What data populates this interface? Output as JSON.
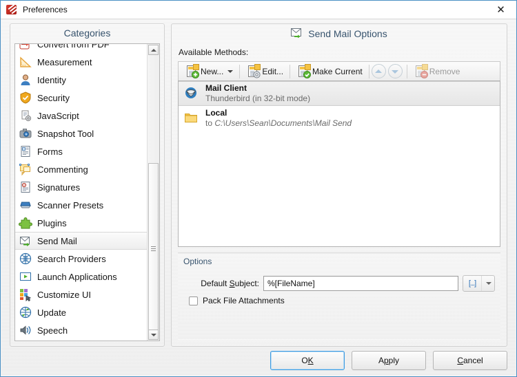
{
  "window": {
    "title": "Preferences",
    "app_icon": "pdf-xchange-icon",
    "close_label": "✕"
  },
  "categories": {
    "header": "Categories",
    "items": [
      {
        "label": "Convert from PDF",
        "icon": "convert-from-pdf-icon",
        "partial": true,
        "selected": false
      },
      {
        "label": "Measurement",
        "icon": "measurement-icon",
        "partial": false,
        "selected": false
      },
      {
        "label": "Identity",
        "icon": "identity-icon",
        "partial": false,
        "selected": false
      },
      {
        "label": "Security",
        "icon": "security-icon",
        "partial": false,
        "selected": false
      },
      {
        "label": "JavaScript",
        "icon": "javascript-icon",
        "partial": false,
        "selected": false
      },
      {
        "label": "Snapshot Tool",
        "icon": "snapshot-tool-icon",
        "partial": false,
        "selected": false
      },
      {
        "label": "Forms",
        "icon": "forms-icon",
        "partial": false,
        "selected": false
      },
      {
        "label": "Commenting",
        "icon": "commenting-icon",
        "partial": false,
        "selected": false
      },
      {
        "label": "Signatures",
        "icon": "signatures-icon",
        "partial": false,
        "selected": false
      },
      {
        "label": "Scanner Presets",
        "icon": "scanner-presets-icon",
        "partial": false,
        "selected": false
      },
      {
        "label": "Plugins",
        "icon": "plugins-icon",
        "partial": false,
        "selected": false
      },
      {
        "label": "Send Mail",
        "icon": "send-mail-icon",
        "partial": false,
        "selected": true
      },
      {
        "label": "Search Providers",
        "icon": "search-providers-icon",
        "partial": false,
        "selected": false
      },
      {
        "label": "Launch Applications",
        "icon": "launch-applications-icon",
        "partial": false,
        "selected": false
      },
      {
        "label": "Customize UI",
        "icon": "customize-ui-icon",
        "partial": false,
        "selected": false
      },
      {
        "label": "Update",
        "icon": "update-icon",
        "partial": false,
        "selected": false
      },
      {
        "label": "Speech",
        "icon": "speech-icon",
        "partial": false,
        "selected": false
      }
    ]
  },
  "panel": {
    "header_title": "Send Mail Options",
    "header_icon": "send-mail-icon",
    "available_methods_label": "Available Methods:",
    "toolbar": [
      {
        "name": "new",
        "label": "New...",
        "icon": "list-add-icon",
        "dropdown": true,
        "disabled": false
      },
      {
        "name": "edit",
        "label": "Edit...",
        "icon": "list-edit-icon",
        "dropdown": false,
        "disabled": false
      },
      {
        "name": "make-current",
        "label": "Make Current",
        "icon": "list-check-icon",
        "dropdown": false,
        "disabled": false
      },
      {
        "name": "remove",
        "label": "Remove",
        "icon": "list-remove-icon",
        "dropdown": false,
        "disabled": true
      }
    ],
    "move_up_label": "Move Up",
    "move_down_label": "Move Down",
    "methods": [
      {
        "name": "Mail Client",
        "detail_prefix": "",
        "detail": "Thunderbird (in 32-bit mode)",
        "detail_italic": "",
        "icon": "thunderbird-icon",
        "selected": true
      },
      {
        "name": "Local",
        "detail_prefix": "to ",
        "detail": "",
        "detail_italic": "C:\\Users\\Sean\\Documents\\Mail Send",
        "icon": "folder-icon",
        "selected": false
      }
    ],
    "options": {
      "group_label": "Options",
      "subject_label_pre": "Default ",
      "subject_label_accel": "S",
      "subject_label_post": "ubject:",
      "subject_value": "%[FileName]",
      "subject_placeholder": "",
      "macro_button_label": "[...]",
      "pack_attachments_label": "Pack File Attachments",
      "pack_attachments_checked": false
    }
  },
  "footer": {
    "ok_pre": "O",
    "ok_accel": "K",
    "ok_post": "",
    "apply_pre": "A",
    "apply_accel": "p",
    "apply_post": "ply",
    "cancel_pre": "",
    "cancel_accel": "C",
    "cancel_post": "ancel"
  },
  "colors": {
    "accent_blue": "#3c9ae0",
    "header_text": "#37536d",
    "window_border": "#4a90c4"
  }
}
